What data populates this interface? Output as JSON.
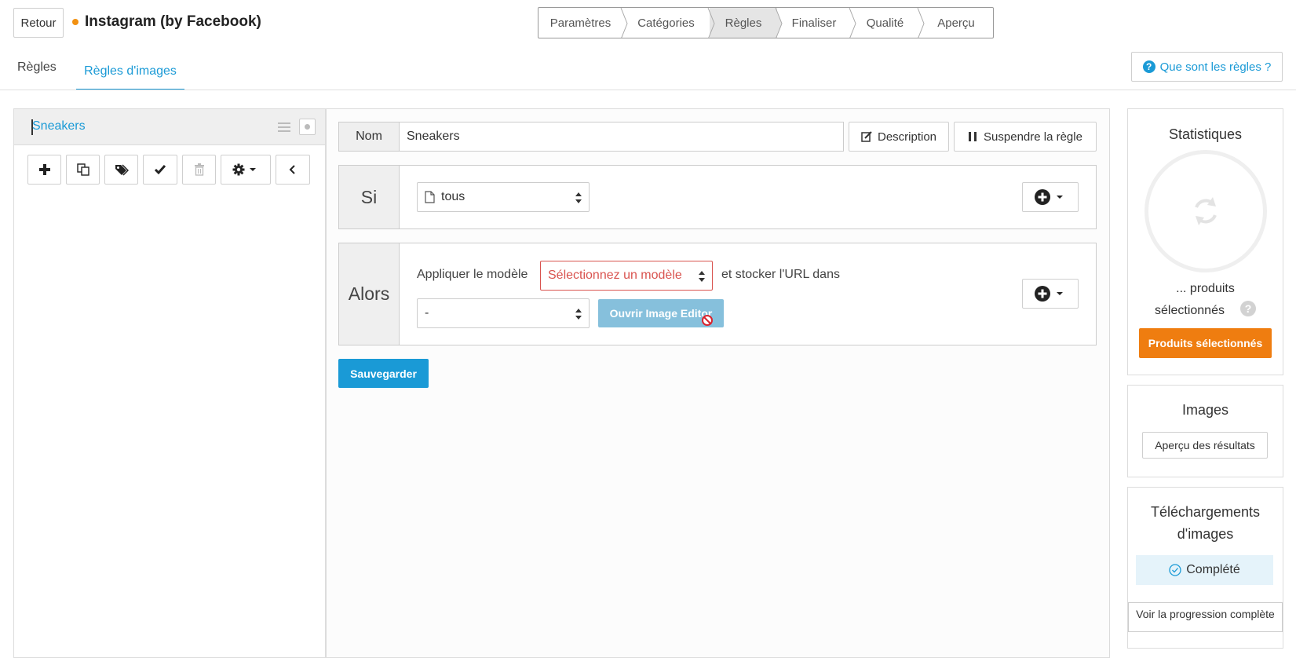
{
  "header": {
    "back_label": "Retour",
    "feed_title": "Instagram (by Facebook)",
    "status_color": "#f29111",
    "wizard_steps": [
      {
        "label": "Paramètres",
        "active": false
      },
      {
        "label": "Catégories",
        "active": false
      },
      {
        "label": "Règles",
        "active": true
      },
      {
        "label": "Finaliser",
        "active": false
      },
      {
        "label": "Qualité",
        "active": false
      },
      {
        "label": "Aperçu",
        "active": false
      }
    ]
  },
  "tabs": {
    "rules": "Règles",
    "image_rules": "Règles d'images",
    "help": "Que sont les règles ?"
  },
  "sidebar": {
    "rule_name": "Sneakers",
    "toolbar_icons": [
      "plus-icon",
      "duplicate-icon",
      "tags-icon",
      "check-icon",
      "trash-icon",
      "gear-icon",
      "chevron-left-icon"
    ]
  },
  "editor": {
    "name_label": "Nom",
    "name_value": "Sneakers",
    "description_label": "Description",
    "suspend_label": "Suspendre la règle",
    "if_label": "Si",
    "if_value": "tous",
    "then_label": "Alors",
    "apply_text": "Appliquer le modèle",
    "template_placeholder": "Sélectionnez un modèle",
    "store_text": "et stocker l'URL dans",
    "store_value": "-",
    "editor_button": "Ouvrir Image Editor",
    "save_label": "Sauvegarder"
  },
  "stats": {
    "title": "Statistiques",
    "count_line1": "... produits",
    "count_line2": "sélectionnés",
    "help": "?",
    "selected_button": "Produits sélectionnés"
  },
  "images": {
    "title": "Images",
    "preview_button": "Aperçu des résultats"
  },
  "downloads": {
    "title": "Téléchargements d'images",
    "status": "Complété",
    "progress_button": "Voir la progression complète"
  },
  "colors": {
    "accent": "#1a9ad6",
    "orange": "#ef7d10",
    "error": "#d9534f"
  }
}
